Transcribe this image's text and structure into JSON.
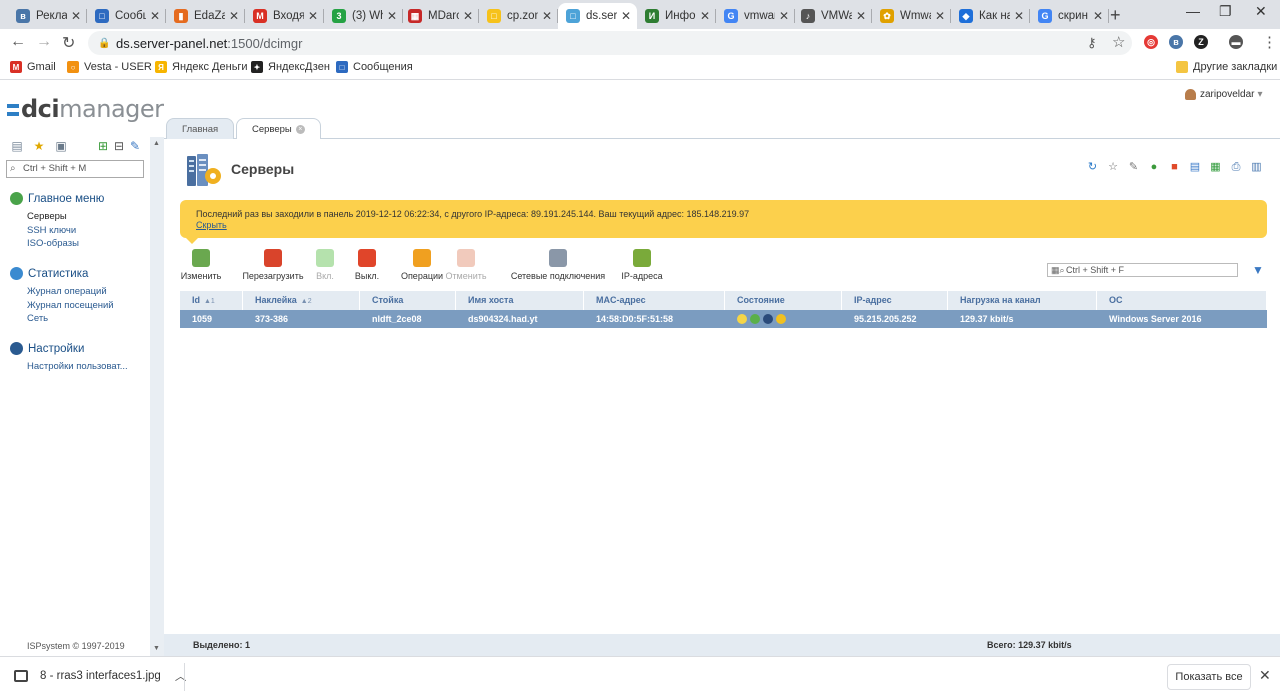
{
  "browser": {
    "tabs": [
      {
        "title": "Реклам",
        "color": "#4a76a8",
        "glyph": "в"
      },
      {
        "title": "Сообщ",
        "color": "#2d6ac0",
        "glyph": "□"
      },
      {
        "title": "EdaZa",
        "color": "#e56b1f",
        "glyph": "▮"
      },
      {
        "title": "Входя",
        "color": "#d93025",
        "glyph": "M"
      },
      {
        "title": "(3) Wh",
        "color": "#25a244",
        "glyph": "3"
      },
      {
        "title": "MDarc",
        "color": "#c62828",
        "glyph": "▦"
      },
      {
        "title": "cp.zon",
        "color": "#f6c21b",
        "glyph": "□"
      },
      {
        "title": "ds.ser",
        "color": "#4da3d8",
        "glyph": "□"
      },
      {
        "title": "Инфо",
        "color": "#2e7d32",
        "glyph": "И"
      },
      {
        "title": "vmwar",
        "color": "#4285f4",
        "glyph": "G"
      },
      {
        "title": "VMWa",
        "color": "#555555",
        "glyph": "♪"
      },
      {
        "title": "Wmwa",
        "color": "#e0a100",
        "glyph": "✿"
      },
      {
        "title": "Как на",
        "color": "#1e6fd9",
        "glyph": "◆"
      },
      {
        "title": "скрин",
        "color": "#4285f4",
        "glyph": "G"
      }
    ],
    "close_glyph": "✕",
    "new_tab_glyph": "+",
    "minimize_glyph": "—",
    "maximize_glyph": "❐",
    "close_window_glyph": "✕",
    "back_glyph": "←",
    "forward_glyph": "→",
    "reload_glyph": "↻",
    "lock_glyph": "🔒",
    "key_glyph": "⚷",
    "star_glyph": "☆",
    "menu_glyph": "⋮",
    "url_host": "ds.server-panel.net",
    "url_path": ":1500/dcimgr",
    "extensions": [
      {
        "glyph": "◎",
        "color": "#e53935"
      },
      {
        "glyph": "в",
        "color": "#4a76a8"
      },
      {
        "glyph": "Z",
        "color": "#222222"
      },
      {
        "glyph": "▬",
        "color": "#555555"
      }
    ],
    "bookmarks": [
      {
        "label": "Gmail",
        "glyph": "M",
        "color": "#d93025"
      },
      {
        "label": "Vesta - USER",
        "glyph": "○",
        "color": "#f29111"
      },
      {
        "label": "Яндекс Деньги",
        "glyph": "Я",
        "color": "#f7b500"
      },
      {
        "label": "ЯндексДзен",
        "glyph": "✦",
        "color": "#222222"
      },
      {
        "label": "Сообщения",
        "glyph": "□",
        "color": "#2d6ac0"
      }
    ],
    "other_bookmarks": "Другие закладки"
  },
  "app": {
    "logo_dci": "dci",
    "logo_manager": "manager",
    "user": "zaripoveldar",
    "user_caret": "▾"
  },
  "sidebar": {
    "tool_glyphs": [
      "▤",
      "★",
      "▣",
      "⊞",
      "⊟",
      "✎"
    ],
    "search_placeholder": "Ctrl + Shift + M",
    "search_glyph": "⌕",
    "sections": [
      {
        "title": "Главное меню",
        "color": "#4aa34a",
        "items": [
          "Серверы",
          "SSH ключи",
          "ISO-образы"
        ]
      },
      {
        "title": "Статистика",
        "color": "#3a8ad0",
        "items": [
          "Журнал операций",
          "Журнал посещений",
          "Сеть"
        ]
      },
      {
        "title": "Настройки",
        "color": "#2a5a90",
        "items": [
          "Настройки пользоват..."
        ]
      }
    ],
    "copyright": "ISPsystem © 1997-2019",
    "scroll_up": "▲",
    "scroll_down": "▼"
  },
  "content_tabs": [
    {
      "label": "Главная"
    },
    {
      "label": "Серверы",
      "close": "×"
    }
  ],
  "page": {
    "title": "Серверы",
    "actions": [
      {
        "glyph": "↻",
        "color": "#2a7ac8",
        "bg": "transparent"
      },
      {
        "glyph": "☆",
        "color": "#666666",
        "bg": "transparent"
      },
      {
        "glyph": "✎",
        "color": "#777777",
        "bg": "transparent"
      },
      {
        "glyph": "●",
        "color": "#3c9a3c",
        "bg": "transparent"
      },
      {
        "glyph": "■",
        "color": "#e04a2a",
        "bg": "transparent"
      },
      {
        "glyph": "▤",
        "color": "#3a7ac8",
        "bg": "transparent"
      },
      {
        "glyph": "▦",
        "color": "#2f9a3a",
        "bg": "transparent"
      },
      {
        "glyph": "⎙",
        "color": "#4a78b0",
        "bg": "transparent"
      },
      {
        "glyph": "▥",
        "color": "#4a78b0",
        "bg": "transparent"
      }
    ]
  },
  "banner": {
    "text": "Последний раз вы заходили в панель 2019-12-12 06:22:34, с другого IP-адреса: 89.191.245.144. Ваш текущий адрес: 185.148.219.97",
    "hide_link": "Скрыть"
  },
  "toolbar": [
    {
      "label": "Изменить",
      "color": "#6aa84f",
      "disabled": false
    },
    {
      "label": "Перезагрузить",
      "color": "#d9442b",
      "disabled": false
    },
    {
      "label": "Вкл.",
      "color": "#5bbf4a",
      "disabled": true
    },
    {
      "label": "Выкл.",
      "color": "#e0452a",
      "disabled": false
    },
    {
      "label": "Операции",
      "color": "#f0a020",
      "disabled": false
    },
    {
      "label": "Отменить",
      "color": "#e08a6a",
      "disabled": true
    },
    {
      "label": "Сетевые подключения",
      "color": "#8a97a8",
      "disabled": false
    },
    {
      "label": "IP-адреса",
      "color": "#7aaa3a",
      "disabled": false
    }
  ],
  "grid": {
    "search_placeholder": "Ctrl + Shift + F",
    "search_glyph": "▦⌕",
    "filter_glyph": "▼",
    "columns": [
      {
        "label": "Id",
        "sort": "▲1"
      },
      {
        "label": "Наклейка",
        "sort": "▲2"
      },
      {
        "label": "Стойка",
        "sort": ""
      },
      {
        "label": "Имя хоста",
        "sort": ""
      },
      {
        "label": "MAC-адрес",
        "sort": ""
      },
      {
        "label": "Состояние",
        "sort": ""
      },
      {
        "label": "IP-адрес",
        "sort": ""
      },
      {
        "label": "Нагрузка на канал",
        "sort": ""
      },
      {
        "label": "ОС",
        "sort": ""
      }
    ],
    "rows": [
      {
        "cells": [
          "1059",
          "373-386",
          "nldft_2ce08",
          "ds904324.had.yt",
          "14:58:D0:5F:51:58",
          "",
          "95.215.205.252",
          "129.37 kbit/s",
          "Windows Server 2016"
        ],
        "state_icons": [
          {
            "name": "power-on-icon",
            "color": "#f5d547"
          },
          {
            "name": "download-icon",
            "color": "#5ab04a"
          },
          {
            "name": "monitor-icon",
            "color": "#2a4a7a"
          },
          {
            "name": "warning-icon",
            "color": "#f0c020"
          }
        ]
      }
    ]
  },
  "footer": {
    "selected": "Выделено: 1",
    "total": "Всего: 129.37 kbit/s"
  },
  "downloads": {
    "file": "8 - rras3 interfaces1.jpg",
    "caret": "︿",
    "show_all": "Показать все",
    "close": "✕"
  }
}
